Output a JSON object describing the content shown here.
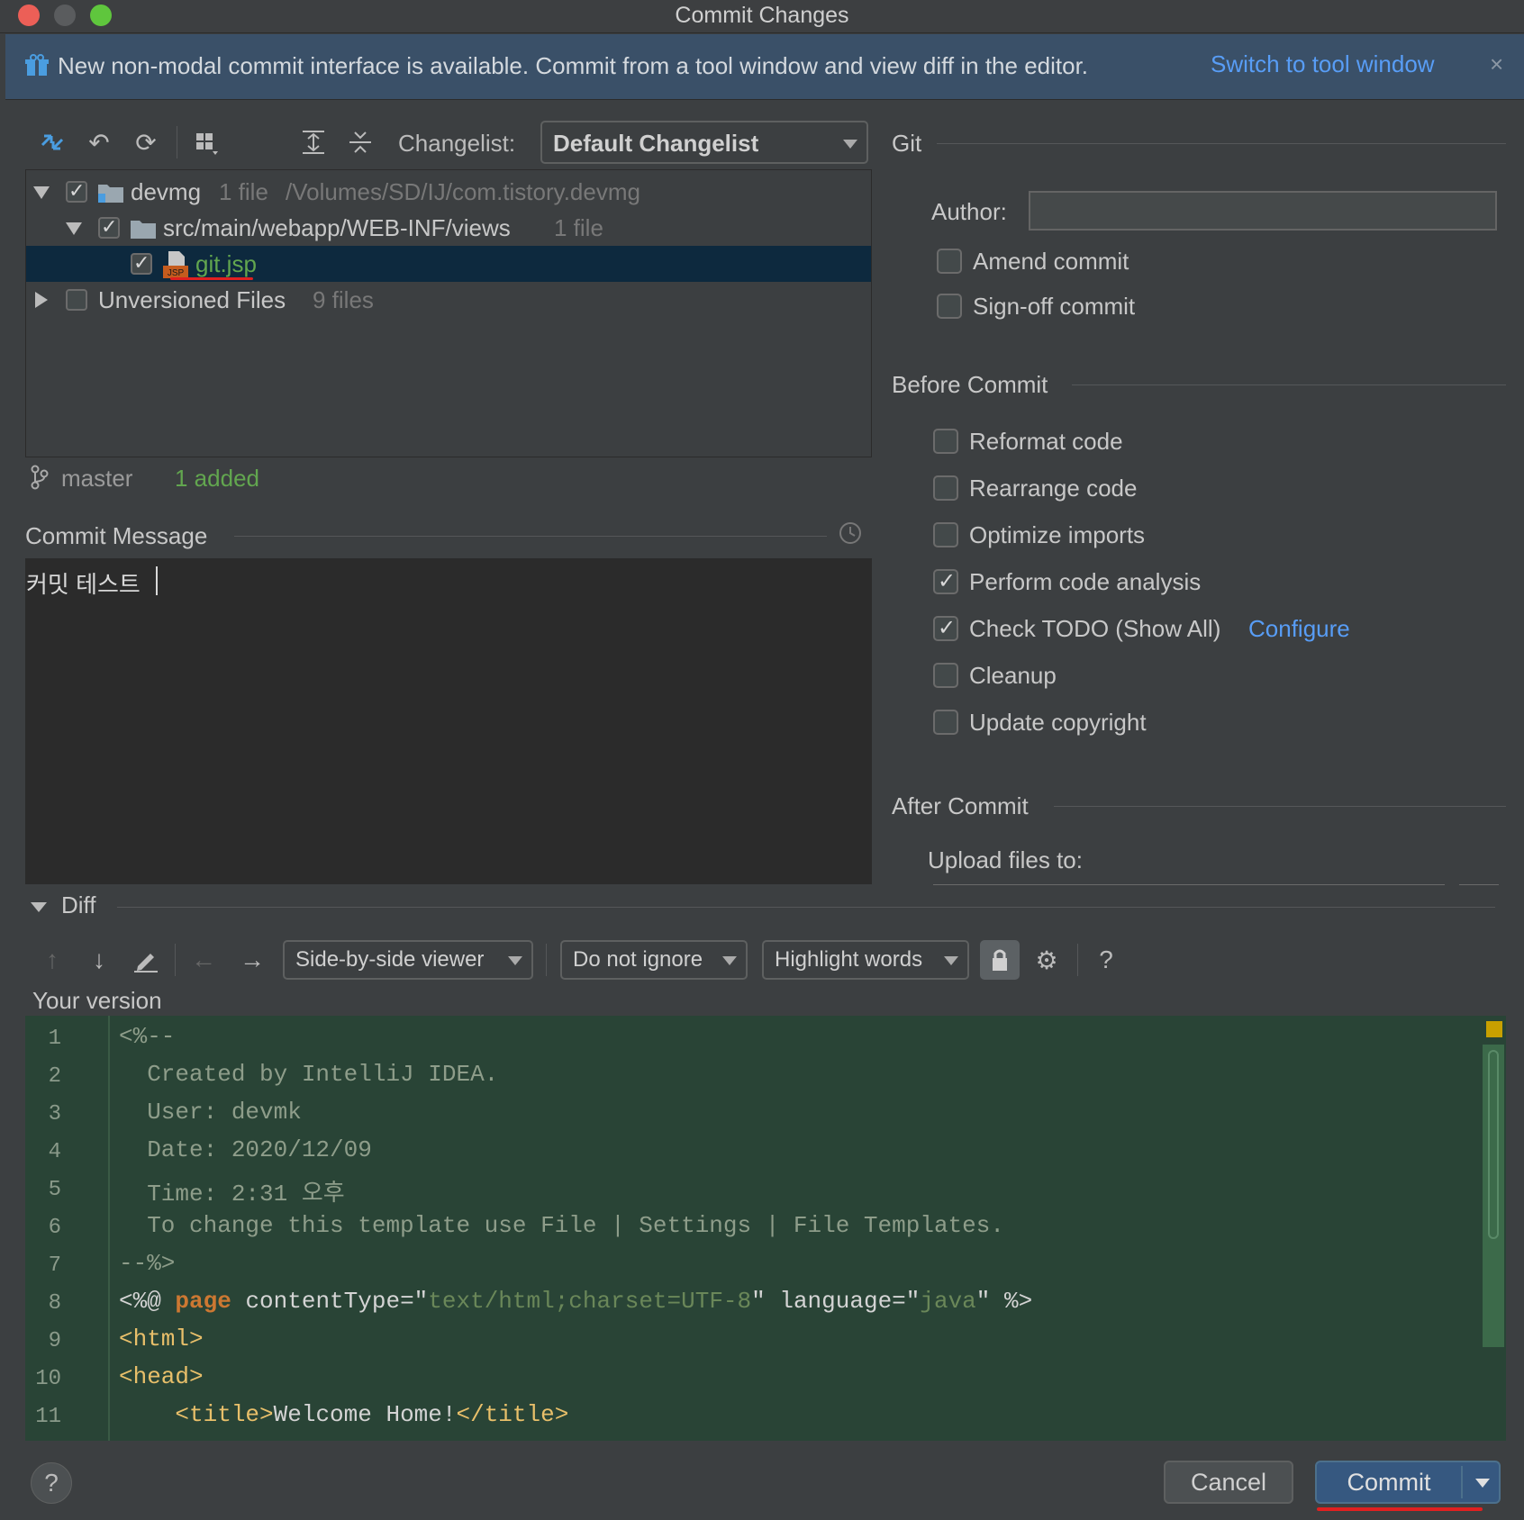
{
  "window": {
    "title": "Commit Changes"
  },
  "banner": {
    "text": "New non-modal commit interface is available. Commit from a tool window and view diff in the editor.",
    "link": "Switch to tool window",
    "close": "×"
  },
  "toolbar": {
    "changelist_label": "Changelist:",
    "changelist_value": "Default Changelist"
  },
  "tree": {
    "root": {
      "name": "devmg",
      "count": "1 file",
      "path": "/Volumes/SD/IJ/com.tistory.devmg"
    },
    "folder": {
      "name": "src/main/webapp/WEB-INF/views",
      "count": "1 file"
    },
    "file": {
      "name": "git.jsp",
      "icon_text": "JSP"
    },
    "unversioned": {
      "name": "Unversioned Files",
      "count": "9 files"
    }
  },
  "status": {
    "branch": "master",
    "summary": "1 added"
  },
  "commit_message": {
    "label": "Commit Message",
    "value": "커밋 테스트"
  },
  "git_panel": {
    "section": "Git",
    "author_label": "Author:",
    "author_value": "",
    "amend": "Amend commit",
    "signoff": "Sign-off commit"
  },
  "before_commit": {
    "section": "Before Commit",
    "reformat": "Reformat code",
    "rearrange": "Rearrange code",
    "optimize": "Optimize imports",
    "analysis": "Perform code analysis",
    "todo": "Check TODO (Show All)",
    "todo_link": "Configure",
    "cleanup": "Cleanup",
    "copyright": "Update copyright"
  },
  "after_commit": {
    "section": "After Commit",
    "upload": "Upload files to:"
  },
  "diff": {
    "label": "Diff",
    "viewer": "Side-by-side viewer",
    "ignore": "Do not ignore",
    "highlight": "Highlight words",
    "help": "?",
    "your_version": "Your version",
    "line_numbers": [
      "1",
      "2",
      "3",
      "4",
      "5",
      "6",
      "7",
      "8",
      "9",
      "10",
      "11"
    ],
    "lines": {
      "l1": "<%--",
      "l2": "  Created by IntelliJ IDEA.",
      "l3": "  User: devmk",
      "l4": "  Date: 2020/12/09",
      "l5": "  Time: 2:31 오후",
      "l6": "  To change this template use File | Settings | File Templates.",
      "l7": "--%>",
      "l8_a": "<%@ ",
      "l8_b": "page",
      "l8_c": " contentType=\"",
      "l8_d": "text/html;charset=UTF-8",
      "l8_e": "\" language=\"",
      "l8_f": "java",
      "l8_g": "\" %>",
      "l9": "<html>",
      "l10": "<head>",
      "l11_a": "    <title>",
      "l11_b": "Welcome Home!",
      "l11_c": "</title>"
    }
  },
  "footer": {
    "help": "?",
    "cancel": "Cancel",
    "commit": "Commit"
  },
  "colors": {
    "accent": "#589df6",
    "added": "#62a64f",
    "diff_bg": "#294436",
    "selection": "#0d293e",
    "underline": "#e02020"
  }
}
